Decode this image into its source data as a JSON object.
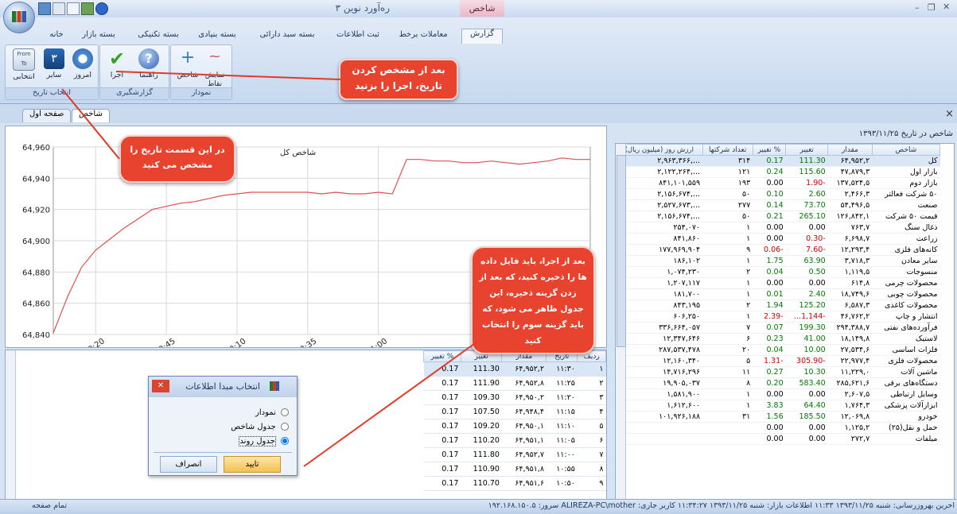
{
  "window": {
    "title": "ره‌آورد نوین ۳",
    "context_tab": "شاخص",
    "controls": [
      "–",
      "❐",
      "✕"
    ]
  },
  "ribbon_tabs": [
    "خانه",
    "بسته بازار",
    "بسته تکنیکی",
    "بسته بنیادی",
    "بسته سبد دارائی",
    "ثبت اطلاعات",
    "معاملات برخط",
    "گزارش"
  ],
  "ribbon": {
    "groups": [
      {
        "label": "انتخاب تاریخ",
        "buttons": [
          "امروز",
          "سایر",
          "انتخابی"
        ]
      },
      {
        "label": "گزارشگیری",
        "buttons": [
          "اجرا",
          "راهنما"
        ]
      },
      {
        "label": "نمودار",
        "buttons": [
          "نمایش نقاط",
          "شاخص"
        ]
      }
    ]
  },
  "doc_tabs": [
    "صفحه اول",
    "شاخص"
  ],
  "close_x": "×",
  "table_header_title": "شاخص در تاریخ ۱۳۹۳/۱۱/۲۵",
  "chart_data": {
    "type": "line",
    "title": "شاخص کل",
    "x": [
      "09:05",
      "09:10",
      "09:15",
      "09:20",
      "09:25",
      "09:30",
      "09:35",
      "09:40",
      "09:45",
      "09:50",
      "09:55",
      "10:00",
      "10:05",
      "10:10",
      "10:15",
      "10:20",
      "10:25",
      "10:30",
      "10:35",
      "10:40",
      "10:45",
      "10:50",
      "10:55",
      "11:00",
      "11:05",
      "11:10",
      "11:15",
      "11:20",
      "11:25",
      "11:30",
      "11:35",
      "11:40",
      "11:45",
      "11:50",
      "11:55",
      "12:00",
      "12:05",
      "12:10",
      "12:15"
    ],
    "xticks": [
      "09:20",
      "09:45",
      "10:10",
      "10:35",
      "11:00"
    ],
    "y": [
      64841,
      64864,
      64883,
      64894,
      64901,
      64908,
      64914,
      64920,
      64922,
      64924,
      64925,
      64927,
      64929,
      64930,
      64931,
      64931,
      64931,
      64931,
      64931,
      64930,
      64931,
      64930,
      64930,
      64931,
      64930,
      64952,
      64952,
      64951,
      64951,
      64950,
      64950,
      64951,
      64950,
      64949,
      64950,
      64951,
      64953,
      64952,
      64952
    ],
    "ylim": [
      64840,
      64960
    ],
    "yticks": [
      "64,840",
      "64,860",
      "64,880",
      "64,900",
      "64,920",
      "64,940",
      "64,960"
    ],
    "grid": true
  },
  "index_table": {
    "columns": [
      "شاخص",
      "مقدار",
      "تغییر",
      "% تغییر",
      "تعداد شرکتها",
      "ارزش روز (میلیون ریال)"
    ],
    "rows": [
      [
        "کل",
        "۶۴,۹۵۲,۲",
        "111.30",
        "0.17",
        "۳۱۴",
        "...,۲,۹۶۳,۳۶۶"
      ],
      [
        "بازار اول",
        "۴۷,۸۷۹,۳",
        "115.60",
        "0.24",
        "۱۲۱",
        "...,۲,۱۲۲,۲۶۴"
      ],
      [
        "بازار دوم",
        "۱۳۷,۵۲۴,۵",
        "-1.90",
        "0.00",
        "۱۹۳",
        "۸۴۱,۱۰۱,۵۵۹"
      ],
      [
        "۵۰ شرکت فعالتر",
        "۲,۴۶۶,۳",
        "2.60",
        "0.10",
        "۵۰",
        "...,۲,۱۵۶,۶۷۴"
      ],
      [
        "صنعت",
        "۵۴,۴۹۶,۵",
        "73.70",
        "0.14",
        "۲۷۷",
        "...,۲,۵۲۷,۶۷۳"
      ],
      [
        "قیمت ۵۰ شرکت",
        "۱۲۶,۸۴۲,۱",
        "265.10",
        "0.21",
        "۵۰",
        "...,۲,۱۵۶,۶۷۴"
      ],
      [
        "ذغال سنگ",
        "۷۶۳,۷",
        "0.00",
        "0.00",
        "۱",
        "۲۵۴,۰۷۰"
      ],
      [
        "زراعت",
        "۶,۶۹۸,۷",
        "-0.30",
        "0.00",
        "۱",
        "۸۴۱,۸۶۰"
      ],
      [
        "کانه‌های فلزی",
        "۱۲,۲۹۳,۴",
        "-7.60",
        "-0.06",
        "۹",
        "۱۷۷,۹۶۹,۹۰۴"
      ],
      [
        "سایر معادن",
        "۳,۷۱۸,۳",
        "63.90",
        "1.75",
        "۱",
        "۱۸۶,۱۰۲"
      ],
      [
        "منسوجات",
        "۱,۱۱۹,۵",
        "0.50",
        "0.04",
        "۲",
        "۱,۰۷۴,۲۳۰"
      ],
      [
        "محصولات چرمی",
        "۶۱۴,۸",
        "0.00",
        "0.00",
        "۱",
        "۱,۲۰۷,۱۱۷"
      ],
      [
        "محصولات چوبی",
        "۱۸,۷۴۹,۶",
        "2.40",
        "0.01",
        "۱",
        "۱۸۱,۷۰۰"
      ],
      [
        "محصولات کاغذی",
        "۶,۵۸۷,۳",
        "125.20",
        "1.94",
        "۲",
        "۸۴۳,۱۹۵"
      ],
      [
        "انتشار و چاپ",
        "۴۶,۷۶۲,۲",
        "-1,144...",
        "-2.39",
        "۱",
        "۶۰۶,۲۵۰"
      ],
      [
        "فرآورده‌های نفتی",
        "۲۹۴,۳۸۸,۷",
        "199.30",
        "0.07",
        "۷",
        "۳۳۶,۶۶۴,۰۵۷"
      ],
      [
        "لاستیک",
        "۱۸,۱۴۹,۸",
        "41.00",
        "0.23",
        "۶",
        "۱۲,۳۴۷,۶۴۶"
      ],
      [
        "فلزات اساسی",
        "۲۷,۵۳۴,۶",
        "10.00",
        "0.04",
        "۲۰",
        "۲۸۷,۵۳۷,۴۷۸"
      ],
      [
        "محصولات فلزی",
        "۲۲,۹۷۷,۴",
        "-305.90",
        "-1.31",
        "۵",
        "۱۲,۱۶۰,۳۴۰"
      ],
      [
        "ماشین آلات",
        "۱۱,۲۲۹,۰",
        "10.30",
        "0.27",
        "۱۱",
        "۱۴,۷۱۶,۲۹۶"
      ],
      [
        "دستگاه‌های برقی",
        "۲۸۵,۶۲۱,۶",
        "583.40",
        "0.20",
        "۸",
        "۱۹,۹۰۵,۰۳۷"
      ],
      [
        "وسایل ارتباطی",
        "۲,۶۰۷,۵",
        "0.00",
        "0.00",
        "۱",
        "۱,۵۸۱,۹۰۰"
      ],
      [
        "ابزارآلات پزشکی",
        "۱,۷۶۴,۳",
        "64.40",
        "3.83",
        "۱",
        "۱,۶۱۲,۶۰۰"
      ],
      [
        "خودرو",
        "۱۲,۰۶۹,۸",
        "185.50",
        "1.56",
        "۳۱",
        "۱۰۱,۹۲۶,۱۸۸"
      ],
      [
        "حمل و نقل(۲۵)",
        "۱,۱۲۵,۲",
        "0.00",
        "0.00",
        "",
        ""
      ],
      [
        "میلفات",
        "۲۷۲,۷",
        "0.00",
        "0.00",
        "",
        ""
      ]
    ]
  },
  "trend_table": {
    "columns": [
      "ردیف",
      "تاریخ",
      "مقدار",
      "تغییر",
      "% تغییر"
    ],
    "rows": [
      [
        "۱",
        "۱۱:۳۰",
        "۶۴,۹۵۲,۲",
        "111.30",
        "0.17"
      ],
      [
        "۲",
        "۱۱:۲۵",
        "۶۴,۹۵۲,۸",
        "111.90",
        "0.17"
      ],
      [
        "۳",
        "۱۱:۲۰",
        "۶۴,۹۵۰,۲",
        "109.30",
        "0.17"
      ],
      [
        "۴",
        "۱۱:۱۵",
        "۶۴,۹۴۸,۴",
        "107.50",
        "0.17"
      ],
      [
        "۵",
        "۱۱:۱۰",
        "۶۴,۹۵۰,۱",
        "109.20",
        "0.17"
      ],
      [
        "۶",
        "۱۱:۰۵",
        "۶۴,۹۵۱,۱",
        "110.20",
        "0.17"
      ],
      [
        "۷",
        "۱۱:۰۰",
        "۶۴,۹۵۲,۷",
        "111.80",
        "0.17"
      ],
      [
        "۸",
        "۱۰:۵۵",
        "۶۴,۹۵۱,۸",
        "110.90",
        "0.17"
      ],
      [
        "۹",
        "۱۰:۵۰",
        "۶۴,۹۵۱,۶",
        "110.70",
        "0.17"
      ]
    ]
  },
  "dialog": {
    "title": "انتخاب مبدا اطلاعات",
    "options": [
      "نمودار",
      "جدول شاخص",
      "جدول روند"
    ],
    "selected": 2,
    "confirm": "تایید",
    "cancel": "انصراف"
  },
  "callouts": {
    "c1": "بعد از مشخص کردن تاریخ، اجرا را بزنید",
    "c2": "در این قسمت تاریخ را مشخص می کنید",
    "c3": "بعد از اجرا، باید فایل داده ها را ذخیره کنید، که بعد از زدن گزینه ذخیره، این جدول ظاهر می شود، که باید گزینه سوم را انتخاب کنید"
  },
  "statusbar": {
    "left": "تمام صفحه",
    "right": "آخرین بهروزرسانی: شنبه ۱۳۹۳/۱۱/۲۵ ۱۱:۳۳   اطلاعات بازار: شنبه ۱۳۹۳/۱۱/۲۵ ۱۱:۳۴:۲۷   کاربر جاری: ALIREZA-PC\\mother   سرور: ۱۹۲.۱۶۸.۱۵۰.۵"
  }
}
